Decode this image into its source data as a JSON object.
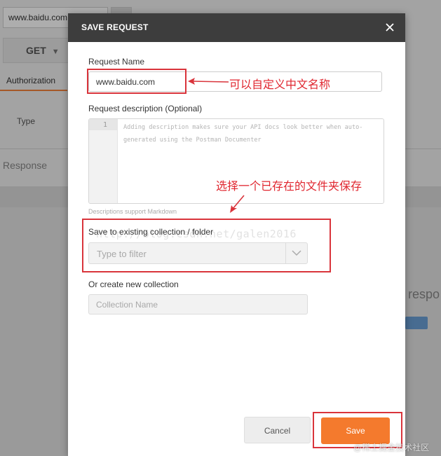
{
  "background": {
    "url_value": "www.baidu.com",
    "method": "GET",
    "tab_auth": "Authorization",
    "type_label": "Type",
    "response_label": "Response",
    "response_fragment": "respo"
  },
  "modal": {
    "title": "SAVE REQUEST",
    "request_name_label": "Request Name",
    "request_name_value": "www.baidu.com",
    "description_label": "Request description (Optional)",
    "description_line_number": "1",
    "description_placeholder": "Adding description makes sure your API docs look better when auto-generated using the Postman Documenter",
    "description_hint": "Descriptions support Markdown",
    "existing_collection_label": "Save to existing collection / folder",
    "filter_placeholder": "Type to filter",
    "new_collection_label": "Or create new collection",
    "collection_name_placeholder": "Collection Name",
    "cancel_label": "Cancel",
    "save_label": "Save"
  },
  "annotations": {
    "name_note": "可以自定义中文名称",
    "collection_note": "选择一个已存在的文件夹保存",
    "blog_watermark": "http://blog.csdn.net/galen2016",
    "footer_watermark": "@稀土掘金技术社区"
  },
  "colors": {
    "header_bg": "#3d3d3d",
    "save_button": "#f47a2d",
    "annotation_red": "#d9343b"
  }
}
